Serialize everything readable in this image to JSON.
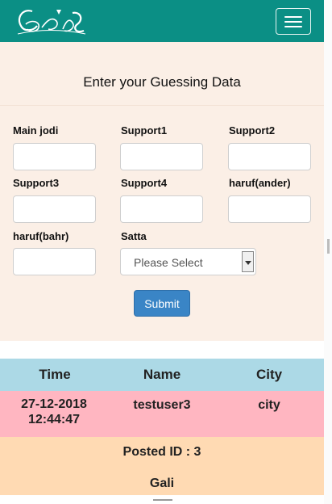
{
  "navbar": {
    "brand_color": "#0b8f85",
    "logo_name": "brand-logo",
    "menu_icon": "hamburger-menu-icon"
  },
  "form": {
    "heading": "Enter your Guessing Data",
    "fields": {
      "main_jodi": {
        "label": "Main jodi",
        "value": ""
      },
      "support1": {
        "label": "Support1",
        "value": ""
      },
      "support2": {
        "label": "Support2",
        "value": ""
      },
      "support3": {
        "label": "Support3",
        "value": ""
      },
      "support4": {
        "label": "Support4",
        "value": ""
      },
      "haruf_ander": {
        "label": "haruf(ander)",
        "value": ""
      },
      "haruf_bahr": {
        "label": "haruf(bahr)",
        "value": ""
      },
      "satta": {
        "label": "Satta",
        "selected": "Please Select"
      }
    },
    "submit_label": "Submit"
  },
  "table": {
    "headers": [
      "Time",
      "Name",
      "City"
    ],
    "row": {
      "time_date": "27-12-2018",
      "time_clock": "12:44:47",
      "name": "testuser3",
      "city": "city"
    },
    "posted_id": "Posted ID : 3",
    "game": "Gali"
  },
  "colors": {
    "panel": "#fbefe6",
    "header_row": "#acd9e6",
    "data_row": "#ffb6c1",
    "footer_row": "#ffdab3",
    "button": "#3a85c6"
  }
}
